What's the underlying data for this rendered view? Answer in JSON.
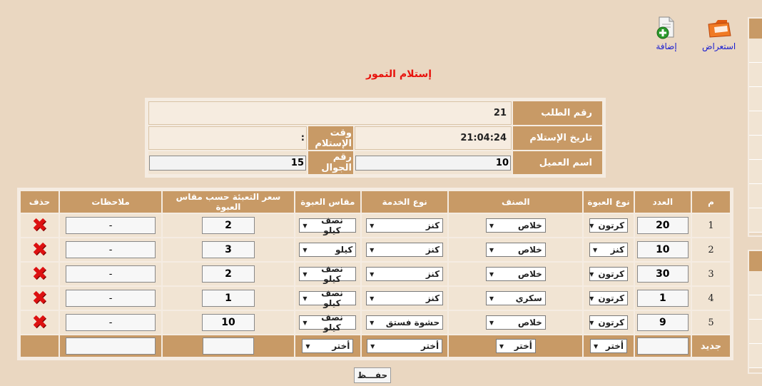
{
  "toolbar": {
    "browse_label": "استعراض",
    "add_label": "إضافة"
  },
  "title": "إستلام التمور",
  "info": {
    "order_no_label": "رقم الطلب",
    "order_no": "21",
    "receipt_date_label": "تاريخ الإستلام",
    "receipt_date": "21:04:24",
    "receipt_time_label": "وقت الإستلام",
    "receipt_time": ":",
    "customer_label": "اسم العميل",
    "customer_value": "10",
    "mobile_label": "رقم الجوال",
    "mobile_value": "15"
  },
  "grid": {
    "headers": {
      "index": "م",
      "count": "العدد",
      "pack_type": "نوع العبوة",
      "variety": "الصنف",
      "service": "نوع الخدمة",
      "pack_size": "مقاس العبوة",
      "price": "سعر التعبئة حسب مقاس العبوة",
      "notes": "ملاحظات",
      "delete": "حذف"
    },
    "rows": [
      {
        "index": "1",
        "count": "20",
        "pack_type": "كرتون",
        "variety": "خلاص",
        "service": "كنز",
        "pack_size": "نصف كيلو",
        "price": "2",
        "notes": "-"
      },
      {
        "index": "2",
        "count": "10",
        "pack_type": "كنز",
        "variety": "خلاص",
        "service": "كنز",
        "pack_size": "كيلو",
        "price": "3",
        "notes": "-"
      },
      {
        "index": "3",
        "count": "30",
        "pack_type": "كرتون",
        "variety": "خلاص",
        "service": "كنز",
        "pack_size": "نصف كيلو",
        "price": "2",
        "notes": "-"
      },
      {
        "index": "4",
        "count": "1",
        "pack_type": "كرتون",
        "variety": "سكري",
        "service": "كنز",
        "pack_size": "نصف كيلو",
        "price": "1",
        "notes": "-"
      },
      {
        "index": "5",
        "count": "9",
        "pack_type": "كرتون",
        "variety": "خلاص",
        "service": "حشوة فستق",
        "pack_size": "نصف كيلو",
        "price": "10",
        "notes": "-"
      }
    ],
    "new_row": {
      "label": "جديد",
      "pack_type": "أختر",
      "variety": "أختر",
      "service": "أختر",
      "pack_size": "أختر"
    }
  },
  "save_label": "حفـــظ",
  "colors": {
    "background": "#ead7c1",
    "header": "#c89a66",
    "title": "#e8120c",
    "link": "#1b1fd0",
    "delete": "#d11111"
  }
}
